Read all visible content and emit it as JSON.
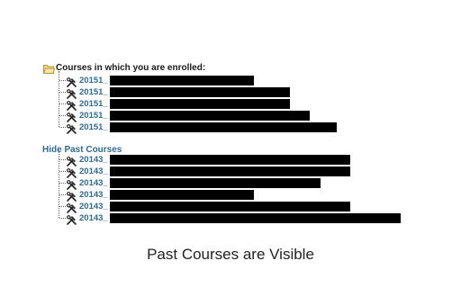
{
  "enrolled_header": "Courses in which you are enrolled:",
  "hide_past_label": "Hide Past Courses",
  "current_courses": [
    {
      "code": "20151_",
      "redacted_width": 160
    },
    {
      "code": "20151_",
      "redacted_width": 200
    },
    {
      "code": "20151_",
      "redacted_width": 200
    },
    {
      "code": "20151_",
      "redacted_width": 222
    },
    {
      "code": "20151_",
      "redacted_width": 252
    }
  ],
  "past_courses": [
    {
      "code": "20143_",
      "redacted_width": 267
    },
    {
      "code": "20143_",
      "redacted_width": 267
    },
    {
      "code": "20143_",
      "redacted_width": 234
    },
    {
      "code": "20143_",
      "redacted_width": 160
    },
    {
      "code": "20143_",
      "redacted_width": 267
    },
    {
      "code": "20143_",
      "redacted_width": 323
    }
  ],
  "caption": "Past Courses are Visible",
  "colors": {
    "link": "#2e6a96",
    "folder": "#e8c56a",
    "redaction": "#000000"
  },
  "icons": {
    "folder": "folder-open-icon",
    "course": "tools-icon"
  }
}
